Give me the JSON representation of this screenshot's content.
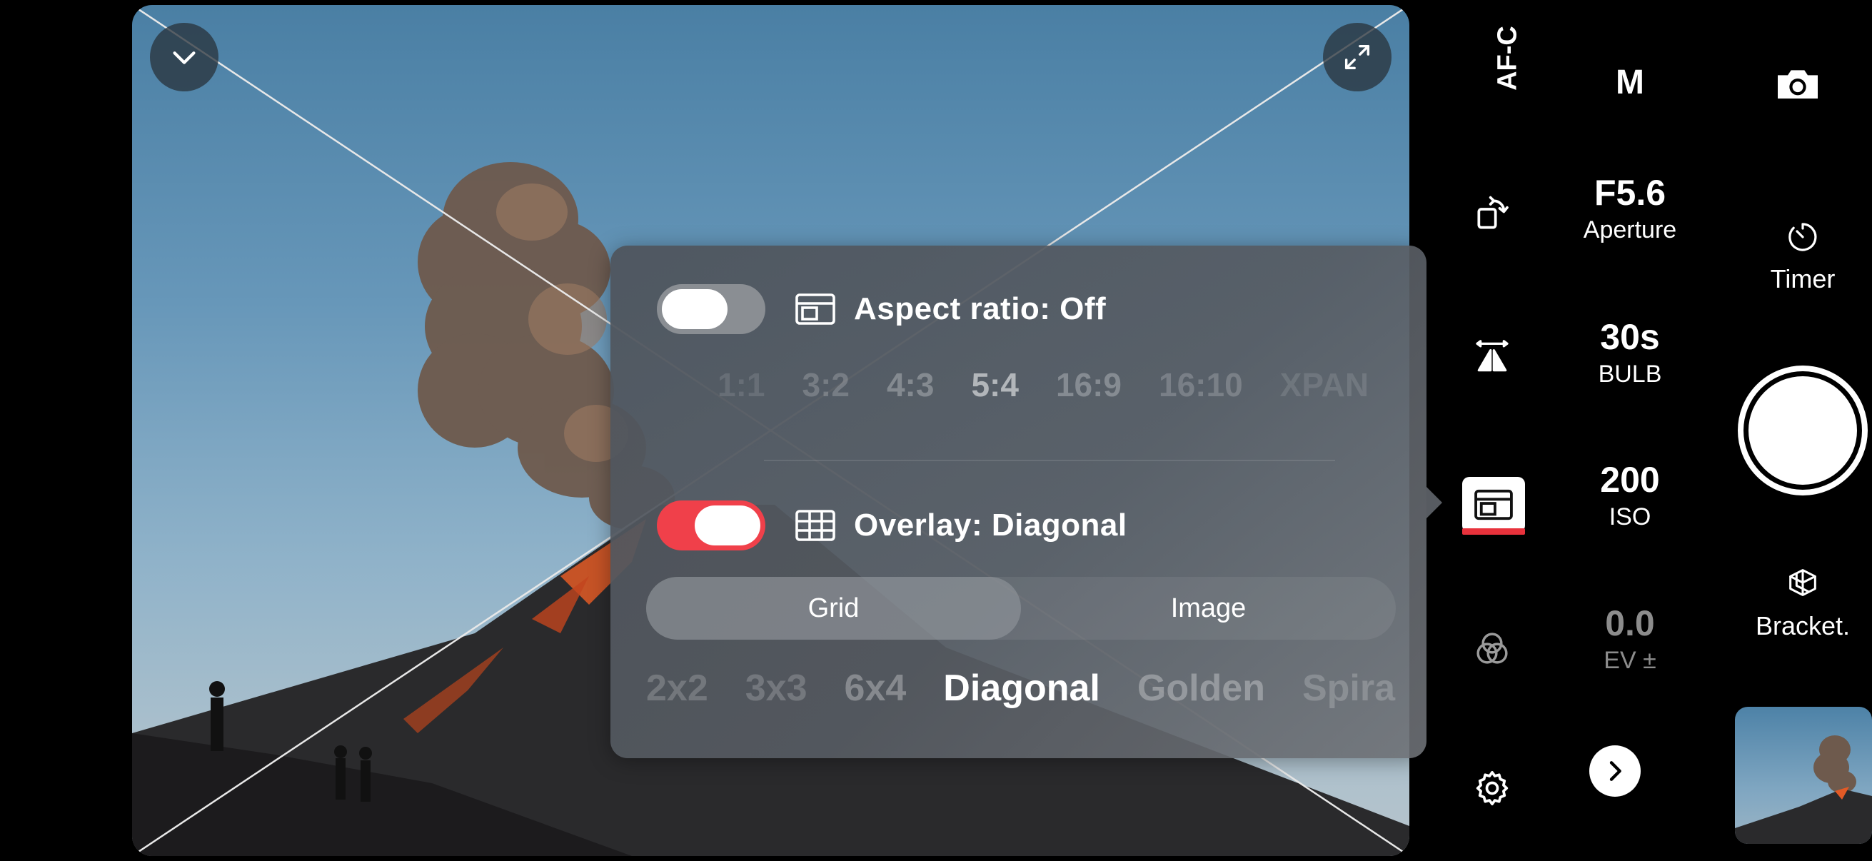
{
  "viewfinder": {
    "collapse_icon": "chevron-down-icon",
    "expand_icon": "expand-arrows-icon"
  },
  "aspect_ratio": {
    "title": "Aspect ratio: Off",
    "enabled": false,
    "options": [
      "1:1",
      "3:2",
      "4:3",
      "5:4",
      "16:9",
      "16:10",
      "XPAN"
    ],
    "selected": "5:4"
  },
  "overlay": {
    "title": "Overlay: Diagonal",
    "enabled": true,
    "tabs": [
      "Grid",
      "Image"
    ],
    "active_tab": "Grid",
    "options": [
      "2x2",
      "3x3",
      "6x4",
      "Diagonal",
      "Golden",
      "Spiral"
    ],
    "selected": "Diagonal"
  },
  "tools": {
    "focus_mode": "AF-C",
    "rotate_icon": "rotate-icon",
    "perspective_icon": "perspective-icon",
    "overlay_icon": "overlay-frame-icon",
    "filters_icon": "color-circles-icon",
    "settings_icon": "gear-icon"
  },
  "exposure": {
    "mode": "M",
    "aperture_value": "F5.6",
    "aperture_label": "Aperture",
    "shutter_value": "30s",
    "shutter_label": "BULB",
    "iso_value": "200",
    "iso_label": "ISO",
    "ev_value": "0.0",
    "ev_label": "EV ±",
    "more_icon": "chevron-right-icon"
  },
  "capture": {
    "camera_icon": "camera-icon",
    "timer_label": "Timer",
    "bracket_label": "Bracket.",
    "accent_color": "#e8323c"
  }
}
